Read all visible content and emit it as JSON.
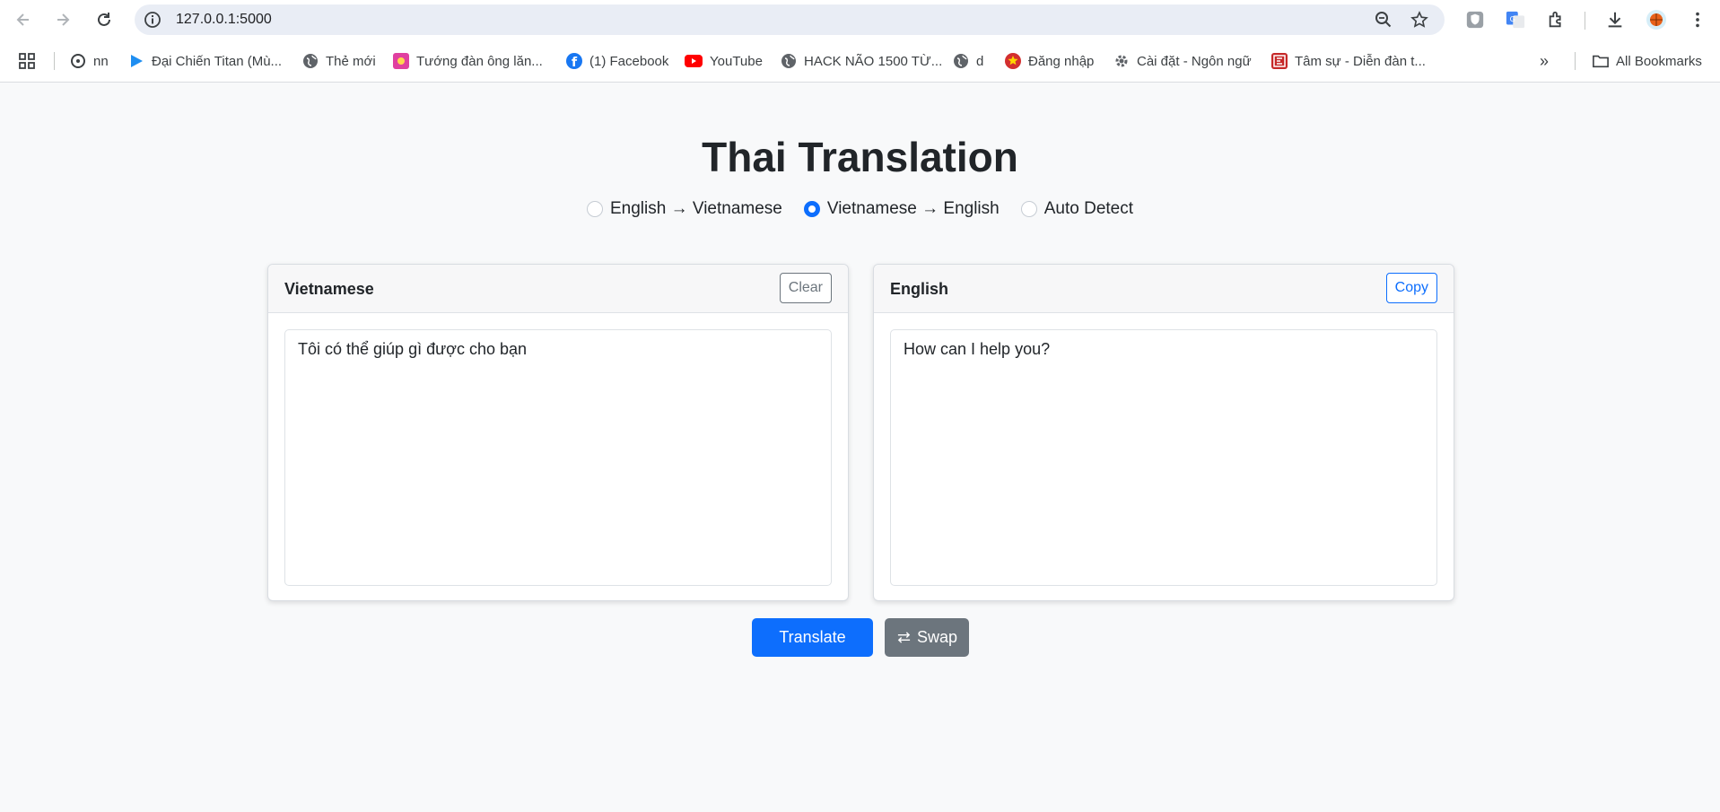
{
  "browser": {
    "url": "127.0.0.1:5000",
    "bookmarks": [
      {
        "label": "nn",
        "icon": "film-icon"
      },
      {
        "label": "Đại Chiến Titan (Mù...",
        "icon": "play-icon"
      },
      {
        "label": "Thẻ mới",
        "icon": "globe-icon"
      },
      {
        "label": "Tướng đàn ông lăn...",
        "icon": "image-icon"
      },
      {
        "label": "(1) Facebook",
        "icon": "facebook-icon"
      },
      {
        "label": "YouTube",
        "icon": "youtube-icon"
      },
      {
        "label": "HACK NÃO 1500 TỪ...",
        "icon": "globe-icon"
      },
      {
        "label": "d",
        "icon": "globe-icon"
      },
      {
        "label": "Đăng nhập",
        "icon": "emblem-icon"
      },
      {
        "label": "Cài đặt - Ngôn ngữ",
        "icon": "gear-icon"
      },
      {
        "label": "Tâm sự - Diễn đàn t...",
        "icon": "forum-icon"
      }
    ],
    "all_bookmarks": "All Bookmarks"
  },
  "page": {
    "title": "Thai Translation",
    "modes": [
      {
        "label": "English → Vietnamese",
        "selected": false
      },
      {
        "label": "Vietnamese → English",
        "selected": true
      },
      {
        "label": "Auto Detect",
        "selected": false
      }
    ]
  },
  "source": {
    "label": "Vietnamese",
    "clear_label": "Clear",
    "text": "Tôi có thể giúp gì được cho bạn"
  },
  "target": {
    "label": "English",
    "copy_label": "Copy",
    "text": "How can I help you?"
  },
  "actions": {
    "translate_label": "Translate",
    "swap_label": "Swap"
  },
  "colors": {
    "primary": "#0d6efd",
    "secondary": "#6c757d",
    "background": "#f8f9fa"
  }
}
